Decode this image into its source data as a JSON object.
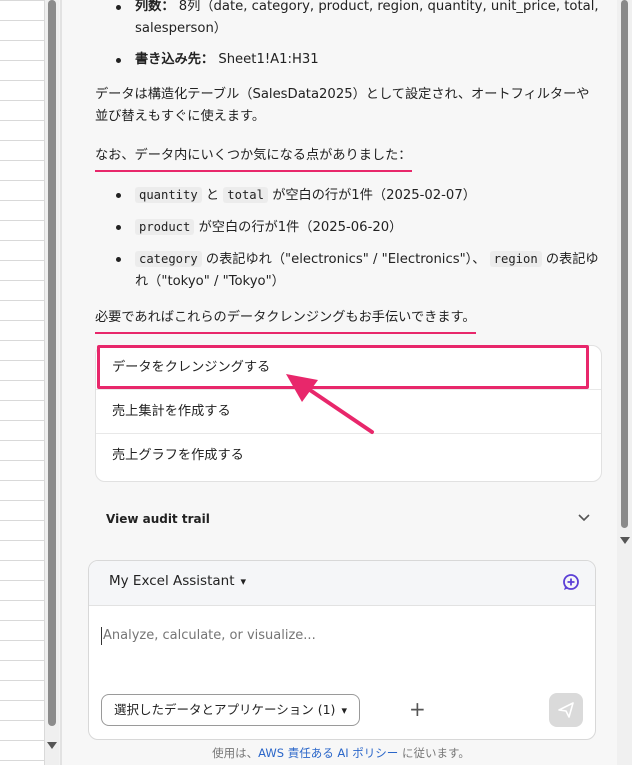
{
  "content": {
    "spec": [
      {
        "label": "列数：",
        "value": "8列（date, category, product, region, quantity, unit_price, total, salesperson）"
      },
      {
        "label": "書き込み先：",
        "value": "Sheet1!A1:H31"
      }
    ],
    "table_note": "データは構造化テーブル（SalesData2025）として設定され、オートフィルターや並び替えもすぐに使えます。",
    "issues_heading": "なお、データ内にいくつか気になる点がありました：",
    "issues": [
      {
        "code1": "quantity",
        "mid": "と",
        "code2": "total",
        "text": "が空白の行が1件（2025-02-07）"
      },
      {
        "code1": "product",
        "text": "が空白の行が1件（2025-06-20）"
      },
      {
        "code1": "category",
        "text": "の表記ゆれ（\"electronics\" / \"Electronics\"）、",
        "code2": "region",
        "text2": "の表記ゆれ（\"tokyo\" / \"Tokyo\"）"
      }
    ],
    "closing": "必要であればこれらのデータクレンジングもお手伝いできます。"
  },
  "suggestions": [
    "データをクレンジングする",
    "売上集計を作成する",
    "売上グラフを作成する"
  ],
  "audit_trail_label": "View audit trail",
  "composer": {
    "title": "My Excel Assistant",
    "placeholder": "Analyze, calculate, or visualize...",
    "context_button": "選択したデータとアプリケーション (1)"
  },
  "policy": {
    "prefix": "使用は、",
    "link": "AWS 責任ある AI ポリシー",
    "suffix": "に従います。"
  },
  "colors": {
    "annotation": "#e8276b",
    "accent_purple": "#5b3fd6",
    "link": "#2a66c9"
  },
  "icons": [
    "chevron-down-icon",
    "new-chat-icon",
    "plus-icon",
    "send-icon",
    "annotation-arrow-icon"
  ]
}
